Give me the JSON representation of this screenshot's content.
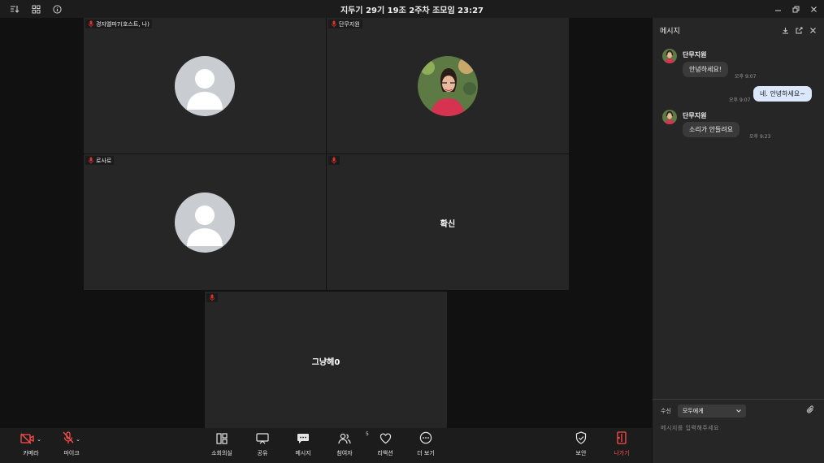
{
  "window": {
    "title": "지두기 29기 19조 2주차 조모임 23:27"
  },
  "tiles": [
    {
      "label": "경자엘파7(호스트, 나)",
      "avatar": "gray-person"
    },
    {
      "label": "단무지원",
      "avatar": "photo"
    },
    {
      "label": "로사로",
      "avatar": "gray-person"
    },
    {
      "label": "",
      "name": "확신"
    },
    {
      "label": "",
      "name": "그냥헤0"
    }
  ],
  "chat": {
    "title": "메시지",
    "messages": [
      {
        "sender": "단무지원",
        "text": "안녕하세요!",
        "time": "오후 9:07",
        "mine": false
      },
      {
        "sender": "",
        "text": "네. 안녕하세요~",
        "time": "오후 9:07",
        "mine": true
      },
      {
        "sender": "단무지원",
        "text": "소리가 안들려요",
        "time": "오후 9:23",
        "mine": false
      }
    ],
    "recipient_label": "수신",
    "recipient_value": "모두에게",
    "input_placeholder": "메시지를 입력해주세요"
  },
  "toolbar": {
    "camera": "카메라",
    "mic": "마이크",
    "breakout": "소회의실",
    "share": "공유",
    "messages": "메시지",
    "participants": "참여자",
    "participants_count": "5",
    "reactions": "리액션",
    "more": "더 보기",
    "security": "보안",
    "leave": "나가기"
  },
  "colors": {
    "leave": "#ff4d4d",
    "muted": "#e0302a",
    "my_bubble": "#dbe7fb"
  }
}
